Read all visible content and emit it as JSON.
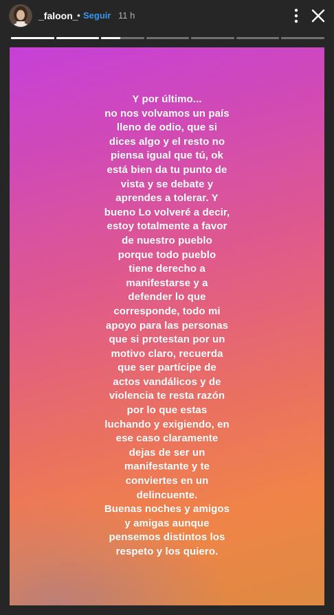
{
  "header": {
    "username": "_faloon_",
    "separator": "•",
    "follow_label": "Seguir",
    "time": "11 h"
  },
  "icons": {
    "avatar": "avatar-photo",
    "more": "more-dots-icon",
    "close": "close-icon"
  },
  "progress": {
    "segments": 7,
    "current_index": 2,
    "current_fraction": 0.45
  },
  "story": {
    "lines": [
      "Y por último...",
      "no nos volvamos un país",
      "lleno de odio, que si",
      "dices algo y el resto no",
      "piensa igual que tú, ok",
      "está bien da tu punto de",
      "vista y se debate y",
      "aprendes a tolerar. Y",
      "bueno Lo volveré a decir,",
      "estoy totalmente a favor",
      "de nuestro pueblo",
      "porque todo pueblo",
      "tiene derecho a",
      "manifestarse y a",
      "defender lo que",
      "corresponde, todo mi",
      "apoyo para las personas",
      "que si protestan por un",
      "motivo claro, recuerda",
      "que ser partícipe de",
      "actos vandálicos y de",
      "violencia te resta razón",
      "por lo que estas",
      "luchando y exigiendo, en",
      "ese caso claramente",
      "dejas de ser un",
      "manifestante y te",
      "conviertes en un",
      "delincuente.",
      "Buenas noches y amigos",
      "y amigas  aunque",
      "pensemos distintos los",
      "respeto y los quiero."
    ]
  },
  "colors": {
    "background": "#262626",
    "follow": "#3897f0",
    "gradient_top": "#c640d8",
    "gradient_mid": "#e05a8a",
    "gradient_bottom": "#f08448"
  }
}
